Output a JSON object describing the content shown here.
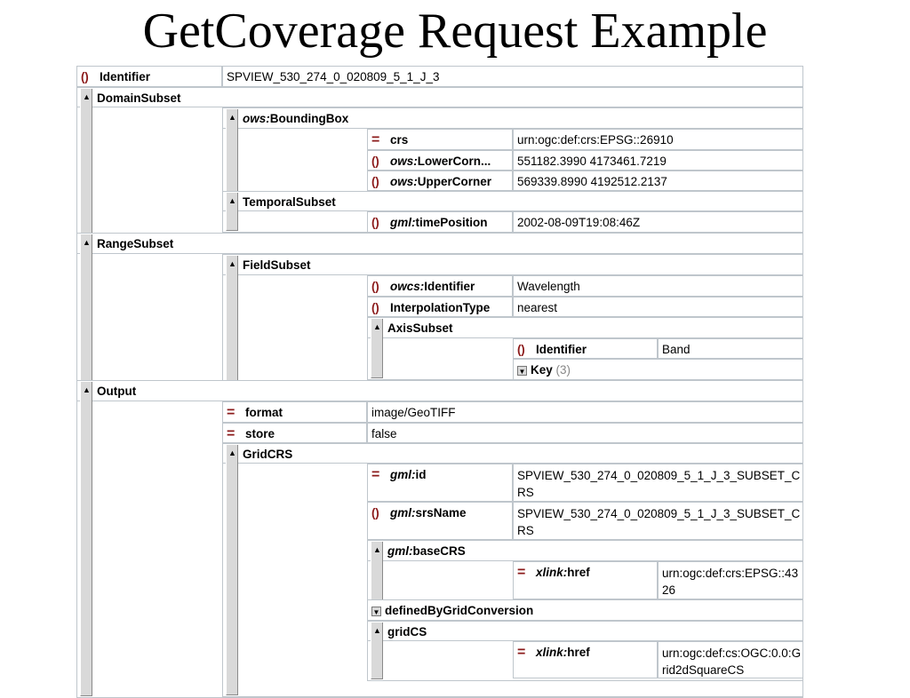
{
  "title": "GetCoverage Request Example",
  "rows": {
    "identifier": {
      "label": "Identifier",
      "value": "SPVIEW_530_274_0_020809_5_1_J_3"
    },
    "domain_subset": {
      "label": "DomainSubset"
    },
    "bounding_box": {
      "ns": "ows:",
      "label": "BoundingBox"
    },
    "crs": {
      "label": "crs",
      "value": "urn:ogc:def:crs:EPSG::26910"
    },
    "lower_corner": {
      "ns": "ows:",
      "label": "LowerCorn...",
      "value": "551182.3990 4173461.7219"
    },
    "upper_corner": {
      "ns": "ows:",
      "label": "UpperCorner",
      "value": "569339.8990 4192512.2137"
    },
    "temporal_subset": {
      "label": "TemporalSubset"
    },
    "time_position": {
      "ns": "gml:",
      "label": "timePosition",
      "value": "2002-08-09T19:08:46Z"
    },
    "range_subset": {
      "label": "RangeSubset"
    },
    "field_subset": {
      "label": "FieldSubset"
    },
    "owcs_identifier": {
      "ns": "owcs:",
      "label": "Identifier",
      "value": "Wavelength"
    },
    "interpolation_type": {
      "label": "InterpolationType",
      "value": "nearest"
    },
    "axis_subset": {
      "label": "AxisSubset"
    },
    "axis_identifier": {
      "label": "Identifier",
      "value": "Band"
    },
    "key": {
      "label": "Key",
      "count": "(3)"
    },
    "output": {
      "label": "Output"
    },
    "format": {
      "label": "format",
      "value": "image/GeoTIFF"
    },
    "store": {
      "label": "store",
      "value": "false"
    },
    "grid_crs": {
      "label": "GridCRS"
    },
    "gml_id": {
      "ns": "gml:",
      "label": "id",
      "value": "SPVIEW_530_274_0_020809_5_1_J_3_SUBSET_CRS"
    },
    "srs_name": {
      "ns": "gml:",
      "label": "srsName",
      "value": "SPVIEW_530_274_0_020809_5_1_J_3_SUBSET_CRS"
    },
    "base_crs": {
      "ns": "gml:",
      "label": "baseCRS"
    },
    "base_crs_href": {
      "ns": "xlink:",
      "label": "href",
      "value": "urn:ogc:def:crs:EPSG::4326"
    },
    "defined_by_grid_conversion": {
      "label": "definedByGridConversion"
    },
    "grid_cs": {
      "label": "gridCS"
    },
    "grid_cs_href": {
      "ns": "xlink:",
      "label": "href",
      "value": "urn:ogc:def:cs:OGC:0.0:Grid2dSquareCS"
    }
  },
  "icons": {
    "element": "element-icon",
    "attribute": "attribute-icon",
    "collapse": "collapse-triangle-icon",
    "expand": "expand-triangle-icon"
  },
  "colors": {
    "icon": "#8b1a1a",
    "border": "#bfc6cc",
    "collapser": "#d9d9d9"
  }
}
